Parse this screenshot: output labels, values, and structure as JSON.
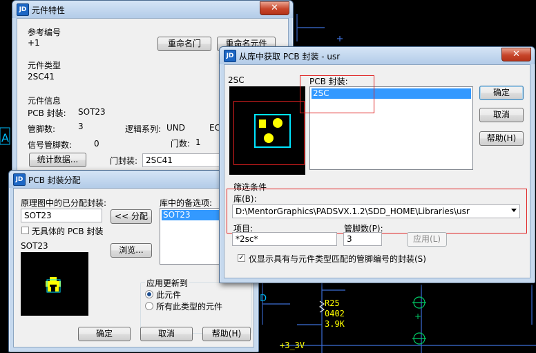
{
  "colors": {
    "schematic_trace": "#3c6fd8",
    "schematic_text": "#ffff00",
    "selection": "#3399ff",
    "highlight": "#e02020",
    "pad": "#ffff00",
    "outline": "#00e5ff"
  },
  "background": {
    "texts": [
      "R25",
      "0402",
      "3.9K",
      "+3_3V",
      "D",
      "A",
      "+"
    ]
  },
  "props_window": {
    "title": "元件特性",
    "ref_label": "参考编号",
    "ref_value": "+1",
    "rename_gate_btn": "重命名门",
    "rename_part_btn": "重命名元件",
    "type_label": "元件类型",
    "type_value": "2SC41",
    "info_label": "元件信息",
    "pcb_label": "PCB 封装:",
    "pcb_value": "SOT23",
    "pins_label": "管脚数:",
    "pins_value": "3",
    "logic_label": "逻辑系列:",
    "logic_value": "UND",
    "logic_value2": "EC",
    "signal_pins_label": "信号管脚数:",
    "signal_pins_value": "0",
    "gates_label": "门数:",
    "gates_value": "1",
    "stats_btn": "统计数据...",
    "gate_pkg_label": "门封装:",
    "gate_pkg_value": "2SC41"
  },
  "assign_window": {
    "title": "PCB 封装分配",
    "assigned_label": "原理图中的已分配封装:",
    "assigned_value": "SOT23",
    "assign_btn": "<< 分配",
    "library_label": "库中的备选项:",
    "library_items": [
      "SOT23"
    ],
    "no_specific_label": "无具体的 PCB 封装",
    "browse_btn": "浏览...",
    "preview_label": "SOT23",
    "apply_group": "应用更新到",
    "radio_this": "此元件",
    "radio_all": "所有此类型的元件",
    "ok": "确定",
    "cancel": "取消",
    "help": "帮助(H)"
  },
  "lib_window": {
    "title": "从库中获取 PCB 封装 - usr",
    "part_label": "2SC",
    "pcb_label": "PCB 封装:",
    "pcb_items": [
      "2SC"
    ],
    "ok": "确定",
    "cancel": "取消",
    "help": "帮助(H)",
    "filter_label": "筛选条件",
    "lib_label": "库(B):",
    "lib_value": "D:\\MentorGraphics\\PADSVX.1.2\\SDD_HOME\\Libraries\\usr",
    "item_label": "项目:",
    "item_value": "*2sc*",
    "pins_label": "管脚数(P):",
    "pins_value": "3",
    "apply_btn": "应用(L)",
    "only_show_label": "仅显示具有与元件类型匹配的管脚编号的封装(S)"
  }
}
